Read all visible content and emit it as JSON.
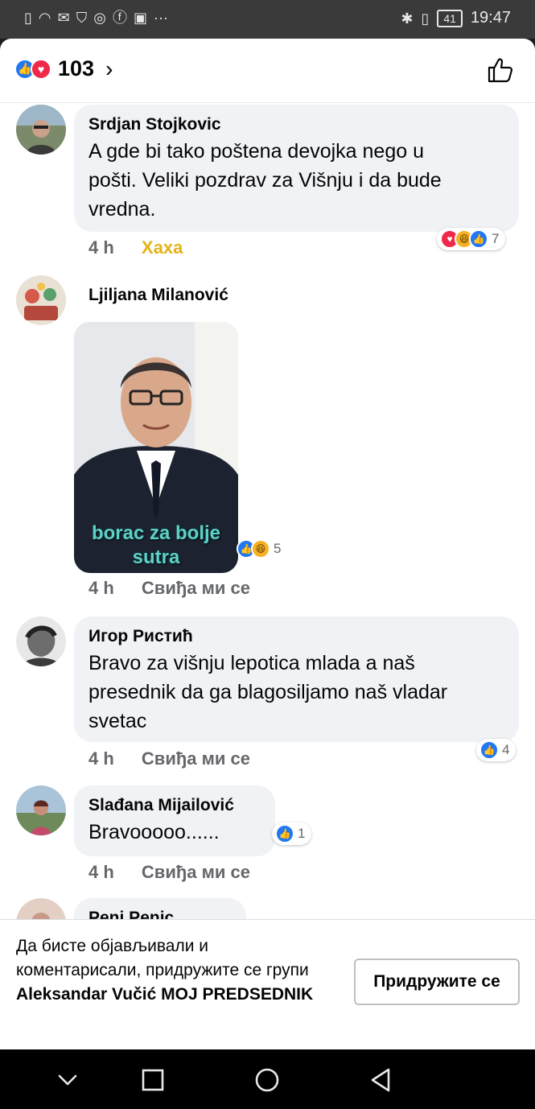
{
  "status_bar": {
    "left_icons": [
      "sim-icon",
      "wifi-icon",
      "mail-icon",
      "shield-icon",
      "instagram-icon",
      "facebook-icon",
      "messenger-icon",
      "more-icon"
    ],
    "battery": "41",
    "time": "19:47"
  },
  "reactions_header": {
    "count": "103",
    "icons": [
      "like",
      "love"
    ]
  },
  "comments": [
    {
      "author": "Srdjan Stojkovic",
      "text_lines": [
        "A gde bi tako poštena devojka nego u",
        "pošti. Veliki pozdrav za Višnju i da bude",
        "vredna."
      ],
      "time": "4 h",
      "action": "Хаха",
      "reaction_count": "7",
      "reaction_icons": [
        "love",
        "haha",
        "like"
      ]
    },
    {
      "author": "Ljiljana Milanović",
      "sticker_caption_lines": [
        "borac za bolje",
        "sutra"
      ],
      "time": "4 h",
      "action": "Свиђа ми се",
      "reaction_count": "5",
      "reaction_icons": [
        "like",
        "haha"
      ]
    },
    {
      "author": "Игор Ристић",
      "text_lines": [
        "Bravo za višnju lepotica mlada a naš",
        "presednik da ga blagosiljamo naš vladar",
        "svetac"
      ],
      "time": "4 h",
      "action": "Свиђа ми се",
      "reaction_count": "4",
      "reaction_icons": [
        "like"
      ]
    },
    {
      "author": "Slađana Mijailović",
      "text_lines": [
        "Bravooooo......"
      ],
      "time": "4 h",
      "action": "Свиђа ми се",
      "reaction_count": "1",
      "reaction_icons": [
        "like"
      ]
    },
    {
      "author": "Peni Penic"
    }
  ],
  "join_prompt": {
    "text_before": "Да бисте објављивали и коментарисали, придружите се групи ",
    "group_name": "Aleksandar Vučić MOJ PREDSEDNIK",
    "button_label": "Придружите се"
  },
  "colors": {
    "like": "#2078f4",
    "love": "#f0284a",
    "haha": "#f7b125",
    "bubble": "#f0f2f5",
    "meta_text": "#65676b"
  }
}
